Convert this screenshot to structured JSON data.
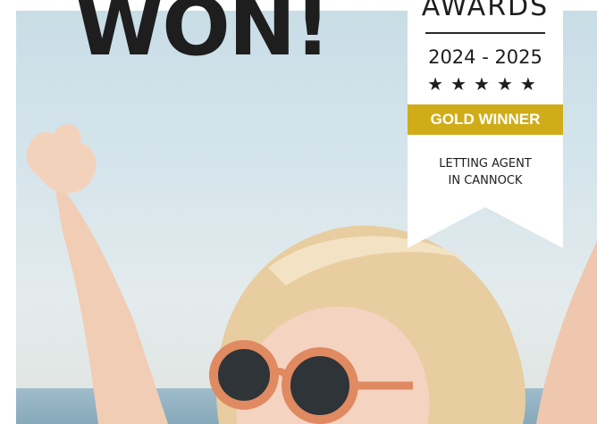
{
  "headline": "WON!",
  "badge": {
    "title": "AWARDS",
    "years": "2024 - 2025",
    "stars": "★★★★★",
    "rating": 5,
    "ribbon": "GOLD WINNER",
    "category_line1": "LETTING AGENT",
    "category_line2": "IN CANNOCK"
  },
  "colors": {
    "gold": "#d0ac19",
    "text": "#1e1e1e",
    "sunglasses_frame": "#e08a62"
  }
}
